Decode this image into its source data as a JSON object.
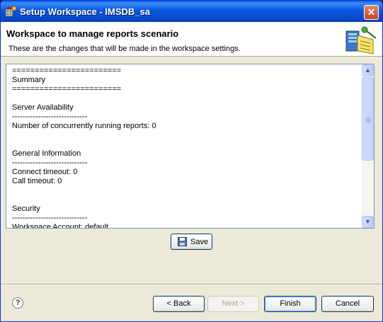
{
  "window": {
    "title": "Setup Workspace - IMSDB_sa"
  },
  "header": {
    "title": "Workspace to manage reports scenario",
    "description": "These are the changes that will be made in the workspace settings."
  },
  "summary_lines": [
    "========================",
    "Summary",
    "========================",
    "",
    "Server Availability",
    "-----------------------------",
    "Number of concurrently running reports: 0",
    "",
    "",
    "General Information",
    "-----------------------------",
    "Connect timeout: 0",
    "Call timeout: 0",
    "",
    "",
    "Security",
    "-----------------------------",
    "Workspace Account: default"
  ],
  "buttons": {
    "save": "Save",
    "back": "< Back",
    "next": "Next >",
    "finish": "Finish",
    "cancel": "Cancel"
  },
  "help": "?",
  "colors": {
    "titlebar": "#0857e0",
    "dialog_bg": "#ece9d8",
    "button_border": "#003c74"
  }
}
